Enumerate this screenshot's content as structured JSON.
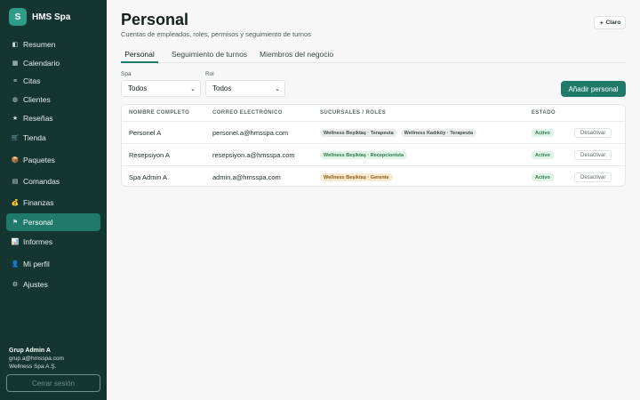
{
  "brand": {
    "logo_letter": "S",
    "name": "HMS Spa"
  },
  "sidebar": {
    "items": [
      {
        "label": "Resumen",
        "icon": "◧",
        "active": false
      },
      {
        "label": "Calendario",
        "icon": "▦",
        "active": false
      },
      {
        "label": "Citas",
        "icon": "≡",
        "active": false
      },
      {
        "label": "Clientes",
        "icon": "◍",
        "active": false
      },
      {
        "label": "Reseñas",
        "icon": "★",
        "active": false
      },
      {
        "label": "Tienda",
        "icon": "🛒",
        "active": false
      },
      {
        "label": "Paquetes",
        "icon": "📦",
        "active": false
      },
      {
        "label": "Comandas",
        "icon": "▤",
        "active": false
      },
      {
        "label": "Finanzas",
        "icon": "💰",
        "active": false
      },
      {
        "label": "Personal",
        "icon": "⚑",
        "active": true
      },
      {
        "label": "Informes",
        "icon": "📊",
        "active": false
      },
      {
        "label": "Mi perfil",
        "icon": "👤",
        "active": false
      },
      {
        "label": "Ajustes",
        "icon": "⚙",
        "active": false
      }
    ],
    "user": {
      "name": "Grup Admin A",
      "email": "grup.a@hmsspa.com",
      "company": "Wellness Spa A.Ş."
    },
    "logout_label": "Cerrar sesión"
  },
  "header": {
    "title": "Personal",
    "subtitle": "Cuentas de empleados, roles, permisos y seguimiento de turnos",
    "theme_icon": "☀",
    "theme_label": "Claro"
  },
  "tabs": [
    {
      "label": "Personal",
      "active": true
    },
    {
      "label": "Seguimiento de turnos",
      "active": false
    },
    {
      "label": "Miembros del negocio",
      "active": false
    }
  ],
  "filters": {
    "spa": {
      "label": "Spa",
      "value": "Todos"
    },
    "role": {
      "label": "Rol",
      "value": "Todos"
    }
  },
  "add_button_label": "Añadir personal",
  "table": {
    "columns": [
      "NOMBRE COMPLETO",
      "CORREO ELECTRÓNICO",
      "SUCURSALES / ROLES",
      "ESTADO"
    ],
    "rows": [
      {
        "name": "Personel A",
        "email": "personel.a@hmsspa.com",
        "roles": [
          {
            "text": "Wellness Beşiktaş · Terapeuta",
            "tone": "grey"
          },
          {
            "text": "Wellness Kadıköy · Terapeuta",
            "tone": "grey"
          }
        ],
        "status": "Activo",
        "action": "Desactivar"
      },
      {
        "name": "Resepsiyon A",
        "email": "resepsiyon.a@hmsspa.com",
        "roles": [
          {
            "text": "Wellness Beşiktaş · Recepcionista",
            "tone": "green"
          }
        ],
        "status": "Activo",
        "action": "Desactivar"
      },
      {
        "name": "Spa Admin A",
        "email": "admin.a@hmsspa.com",
        "roles": [
          {
            "text": "Wellness Beşiktaş · Gerente",
            "tone": "amber"
          }
        ],
        "status": "Activo",
        "action": "Desactivar"
      }
    ]
  }
}
